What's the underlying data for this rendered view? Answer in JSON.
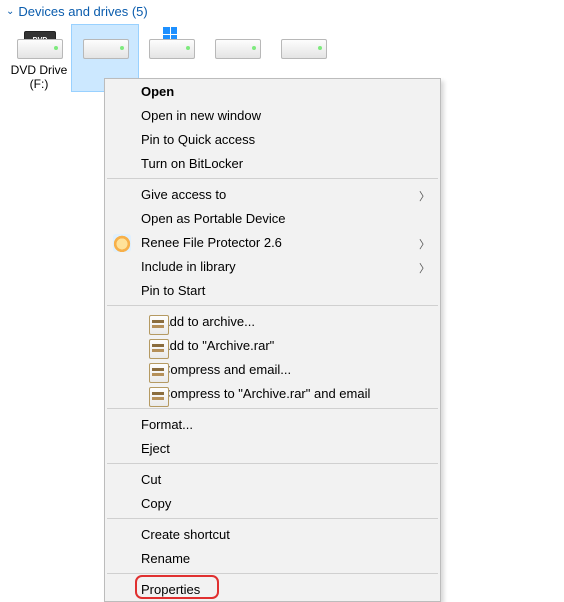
{
  "section": {
    "title": "Devices and drives (5)"
  },
  "drives": [
    {
      "label1": "DVD Drive",
      "label2": "(F:)"
    }
  ],
  "menu": {
    "open": "Open",
    "open_new_window": "Open in new window",
    "pin_quick_access": "Pin to Quick access",
    "turn_on_bitlocker": "Turn on BitLocker",
    "give_access_to": "Give access to",
    "open_as_portable": "Open as Portable Device",
    "renee": "Renee File Protector 2.6",
    "include_in_library": "Include in library",
    "pin_to_start": "Pin to Start",
    "add_to_archive": "Add to archive...",
    "add_to_archive_rar": "Add to \"Archive.rar\"",
    "compress_and_email": "Compress and email...",
    "compress_archive_email": "Compress to \"Archive.rar\" and email",
    "format": "Format...",
    "eject": "Eject",
    "cut": "Cut",
    "copy": "Copy",
    "create_shortcut": "Create shortcut",
    "rename": "Rename",
    "properties": "Properties"
  }
}
